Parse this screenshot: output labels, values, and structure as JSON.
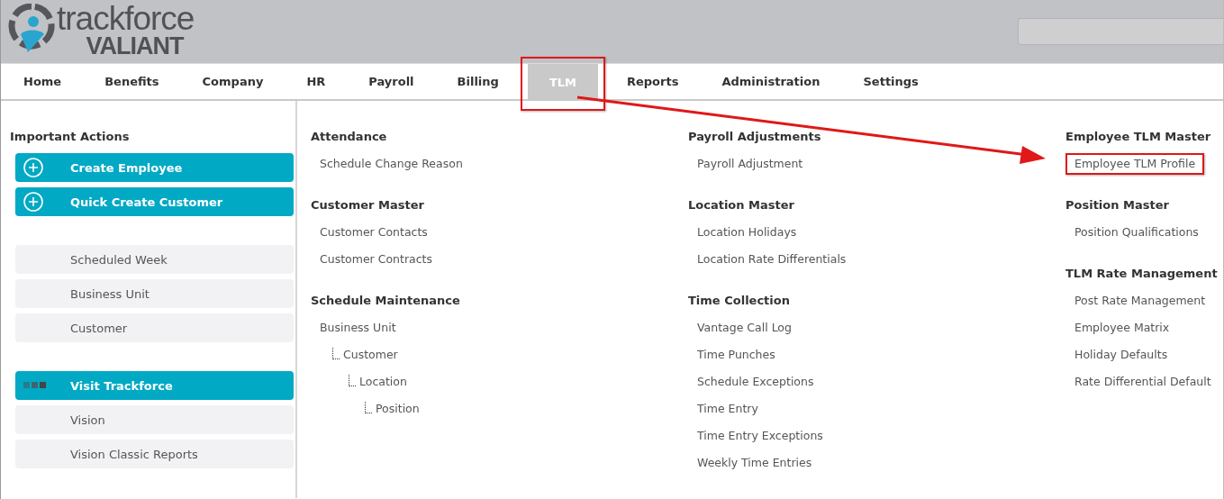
{
  "header": {
    "logo": {
      "name": "trackforce",
      "product": "VALIANT"
    }
  },
  "nav": [
    {
      "label": "Home",
      "selected": false,
      "annotated": false
    },
    {
      "label": "Benefits",
      "selected": false,
      "annotated": false
    },
    {
      "label": "Company",
      "selected": false,
      "annotated": false
    },
    {
      "label": "HR",
      "selected": false,
      "annotated": false
    },
    {
      "label": "Payroll",
      "selected": false,
      "annotated": false
    },
    {
      "label": "Billing",
      "selected": false,
      "annotated": false
    },
    {
      "label": "TLM",
      "selected": true,
      "annotated": true
    },
    {
      "label": "Reports",
      "selected": false,
      "annotated": false
    },
    {
      "label": "Administration",
      "selected": false,
      "annotated": false
    },
    {
      "label": "Settings",
      "selected": false,
      "annotated": false
    }
  ],
  "sidebar": {
    "title": "Important Actions",
    "groups": [
      [
        {
          "label": "Create Employee",
          "kind": "add"
        },
        {
          "label": "Quick Create Customer",
          "kind": "add"
        }
      ],
      [
        {
          "label": "Scheduled Week",
          "kind": "secondary"
        },
        {
          "label": "Business Unit",
          "kind": "secondary"
        },
        {
          "label": "Customer",
          "kind": "secondary"
        }
      ],
      [
        {
          "label": "Visit Trackforce",
          "kind": "visit"
        },
        {
          "label": "Vision",
          "kind": "secondary"
        },
        {
          "label": "Vision Classic Reports",
          "kind": "secondary"
        }
      ]
    ]
  },
  "menu_columns": [
    [
      {
        "title": "Attendance",
        "items": [
          {
            "label": "Schedule Change Reason",
            "annotated": false
          }
        ]
      },
      {
        "title": "Customer Master",
        "items": [
          {
            "label": "Customer Contacts",
            "annotated": false
          },
          {
            "label": "Customer Contracts",
            "annotated": false
          }
        ]
      },
      {
        "title": "Schedule Maintenance",
        "items": [
          {
            "label": "Business Unit",
            "annotated": false,
            "children": [
              {
                "label": "Customer",
                "annotated": false,
                "children": [
                  {
                    "label": "Location",
                    "annotated": false,
                    "children": [
                      {
                        "label": "Position",
                        "annotated": false
                      }
                    ]
                  }
                ]
              }
            ]
          }
        ]
      }
    ],
    [
      {
        "title": "Payroll Adjustments",
        "items": [
          {
            "label": "Payroll Adjustment",
            "annotated": false
          }
        ]
      },
      {
        "title": "Location Master",
        "items": [
          {
            "label": "Location Holidays",
            "annotated": false
          },
          {
            "label": "Location Rate Differentials",
            "annotated": false
          }
        ]
      },
      {
        "title": "Time Collection",
        "items": [
          {
            "label": "Vantage Call Log",
            "annotated": false
          },
          {
            "label": "Time Punches",
            "annotated": false
          },
          {
            "label": "Schedule Exceptions",
            "annotated": false
          },
          {
            "label": "Time Entry",
            "annotated": false
          },
          {
            "label": "Time Entry Exceptions",
            "annotated": false
          },
          {
            "label": "Weekly Time Entries",
            "annotated": false
          }
        ]
      }
    ],
    [
      {
        "title": "Employee TLM Master",
        "items": [
          {
            "label": "Employee TLM Profile",
            "annotated": true
          }
        ]
      },
      {
        "title": "Position Master",
        "items": [
          {
            "label": "Position Qualifications",
            "annotated": false
          }
        ]
      },
      {
        "title": "TLM Rate Management",
        "items": [
          {
            "label": "Post Rate Management",
            "annotated": false
          },
          {
            "label": "Employee Matrix",
            "annotated": false
          },
          {
            "label": "Holiday Defaults",
            "annotated": false
          },
          {
            "label": "Rate Differential Default",
            "annotated": false
          }
        ]
      }
    ]
  ],
  "annotation_arrow": {
    "kind": "arrow"
  }
}
